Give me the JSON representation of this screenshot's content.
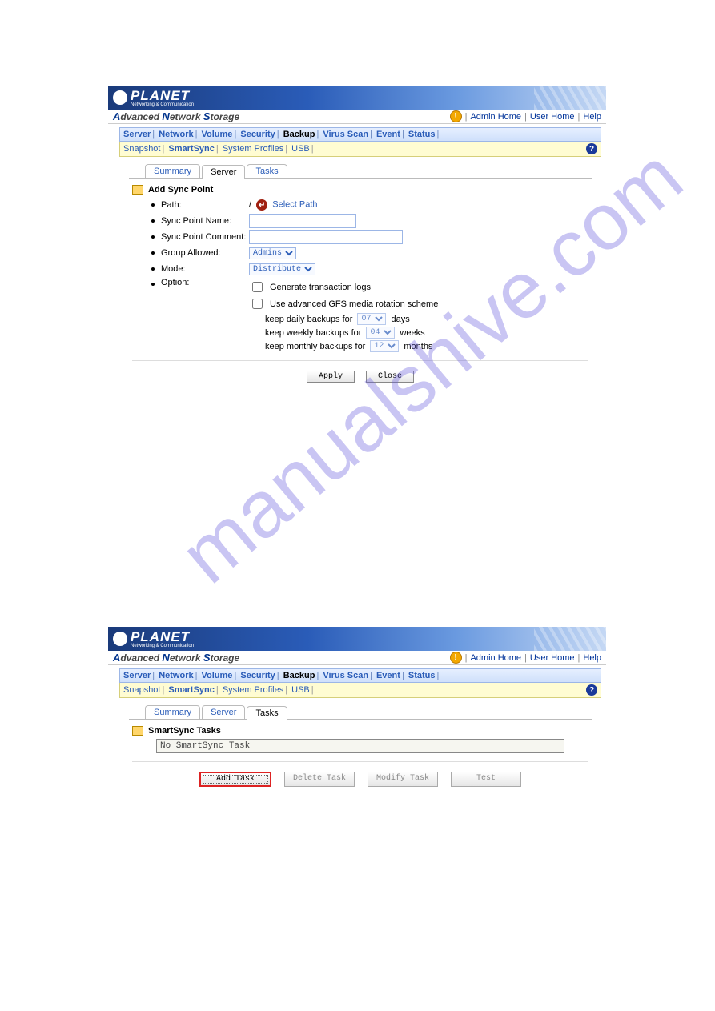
{
  "brand": "PLANET",
  "brand_sub": "Networking & Communication",
  "product_title": "Advanced Network Storage",
  "toplinks": {
    "admin": "Admin Home",
    "user": "User Home",
    "help": "Help"
  },
  "maintabs": [
    "Server",
    "Network",
    "Volume",
    "Security",
    "Backup",
    "Virus Scan",
    "Event",
    "Status"
  ],
  "maintabs_active": "Backup",
  "subtabs": [
    "Snapshot",
    "SmartSync",
    "System Profiles",
    "USB"
  ],
  "subtabs_active": "SmartSync",
  "panel1": {
    "tabs": [
      "Summary",
      "Server",
      "Tasks"
    ],
    "active_tab": "Server",
    "section_title": "Add Sync Point",
    "fields": {
      "path_label": "Path:",
      "path_root": "/",
      "path_link": "Select Path",
      "name_label": "Sync Point Name:",
      "comment_label": "Sync Point Comment:",
      "group_label": "Group Allowed:",
      "group_value": "Admins",
      "mode_label": "Mode:",
      "mode_value": "Distribute",
      "option_label": "Option:",
      "opt1": "Generate transaction logs",
      "opt2": "Use advanced GFS media rotation scheme",
      "gfs_daily_label_pre": "keep daily backups for",
      "gfs_daily_val": "07",
      "gfs_daily_label_post": "days",
      "gfs_weekly_label_pre": "keep weekly backups for",
      "gfs_weekly_val": "04",
      "gfs_weekly_label_post": "weeks",
      "gfs_monthly_label_pre": "keep monthly backups for",
      "gfs_monthly_val": "12",
      "gfs_monthly_label_post": "months"
    },
    "buttons": {
      "apply": "Apply",
      "close": "Close"
    }
  },
  "panel2": {
    "tabs": [
      "Summary",
      "Server",
      "Tasks"
    ],
    "active_tab": "Tasks",
    "section_title": "SmartSync Tasks",
    "empty_msg": "No SmartSync Task",
    "buttons": {
      "add": "Add Task",
      "delete": "Delete Task",
      "modify": "Modify Task",
      "test": "Test"
    }
  },
  "watermark": "manualshive.com"
}
